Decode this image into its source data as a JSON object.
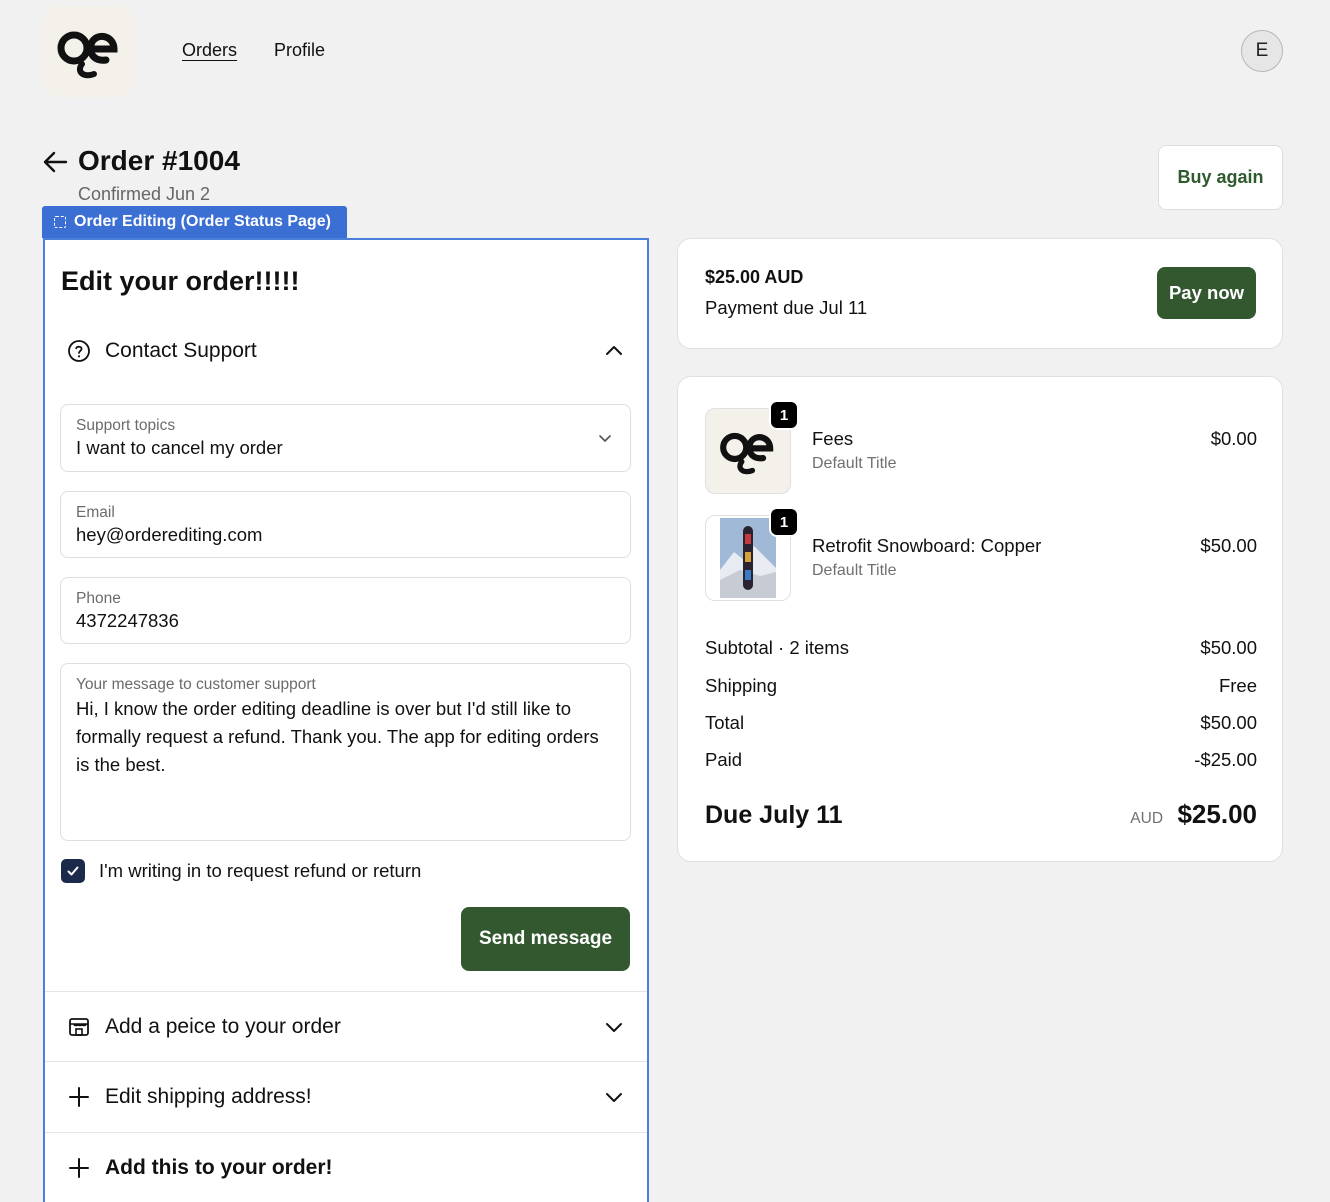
{
  "header": {
    "logo_alt": "oe",
    "nav": [
      {
        "label": "Orders",
        "active": true
      },
      {
        "label": "Profile",
        "active": false
      }
    ],
    "avatar_initial": "E"
  },
  "order": {
    "title": "Order #1004",
    "confirmed": "Confirmed Jun 2",
    "buy_again_label": "Buy again"
  },
  "app_block": {
    "tag_label": "Order Editing (Order Status Page)",
    "title": "Edit your order!!!!!",
    "contact_support": {
      "heading": "Contact Support",
      "support_topics": {
        "label": "Support topics",
        "value": "I want to cancel my order"
      },
      "email": {
        "label": "Email",
        "value": "hey@orderediting.com"
      },
      "phone": {
        "label": "Phone",
        "value": "4372247836"
      },
      "message": {
        "label": "Your message to customer support",
        "value": "Hi, I know the order editing deadline is over but I'd still like to formally request a refund. Thank you. The app for editing orders is the best."
      },
      "checkbox_label": "I'm writing in to request refund or return",
      "checkbox_checked": true,
      "send_label": "Send message"
    },
    "sections": [
      {
        "heading": "Add a peice to your order"
      },
      {
        "heading": "Edit shipping address!"
      },
      {
        "heading": "Add this to your order!"
      }
    ]
  },
  "payment": {
    "amount": "$25.00 AUD",
    "due": "Payment due Jul 11",
    "pay_label": "Pay now"
  },
  "summary": {
    "items": [
      {
        "qty": "1",
        "name": "Fees",
        "variant": "Default Title",
        "price": "$0.00"
      },
      {
        "qty": "1",
        "name": "Retrofit Snowboard: Copper",
        "variant": "Default Title",
        "price": "$50.00"
      }
    ],
    "rows": [
      {
        "label": "Subtotal · 2 items",
        "value": "$50.00"
      },
      {
        "label": "Shipping",
        "value": "Free"
      },
      {
        "label": "Total",
        "value": "$50.00"
      },
      {
        "label": "Paid",
        "value": "-$25.00"
      }
    ],
    "due_label": "Due July 11",
    "due_currency": "AUD",
    "due_amount": "$25.00"
  },
  "colors": {
    "background": "#f0f1f0",
    "primary_button": "#33582f",
    "app_accent": "#3b6fd4",
    "checkbox": "#1b2a4a"
  }
}
